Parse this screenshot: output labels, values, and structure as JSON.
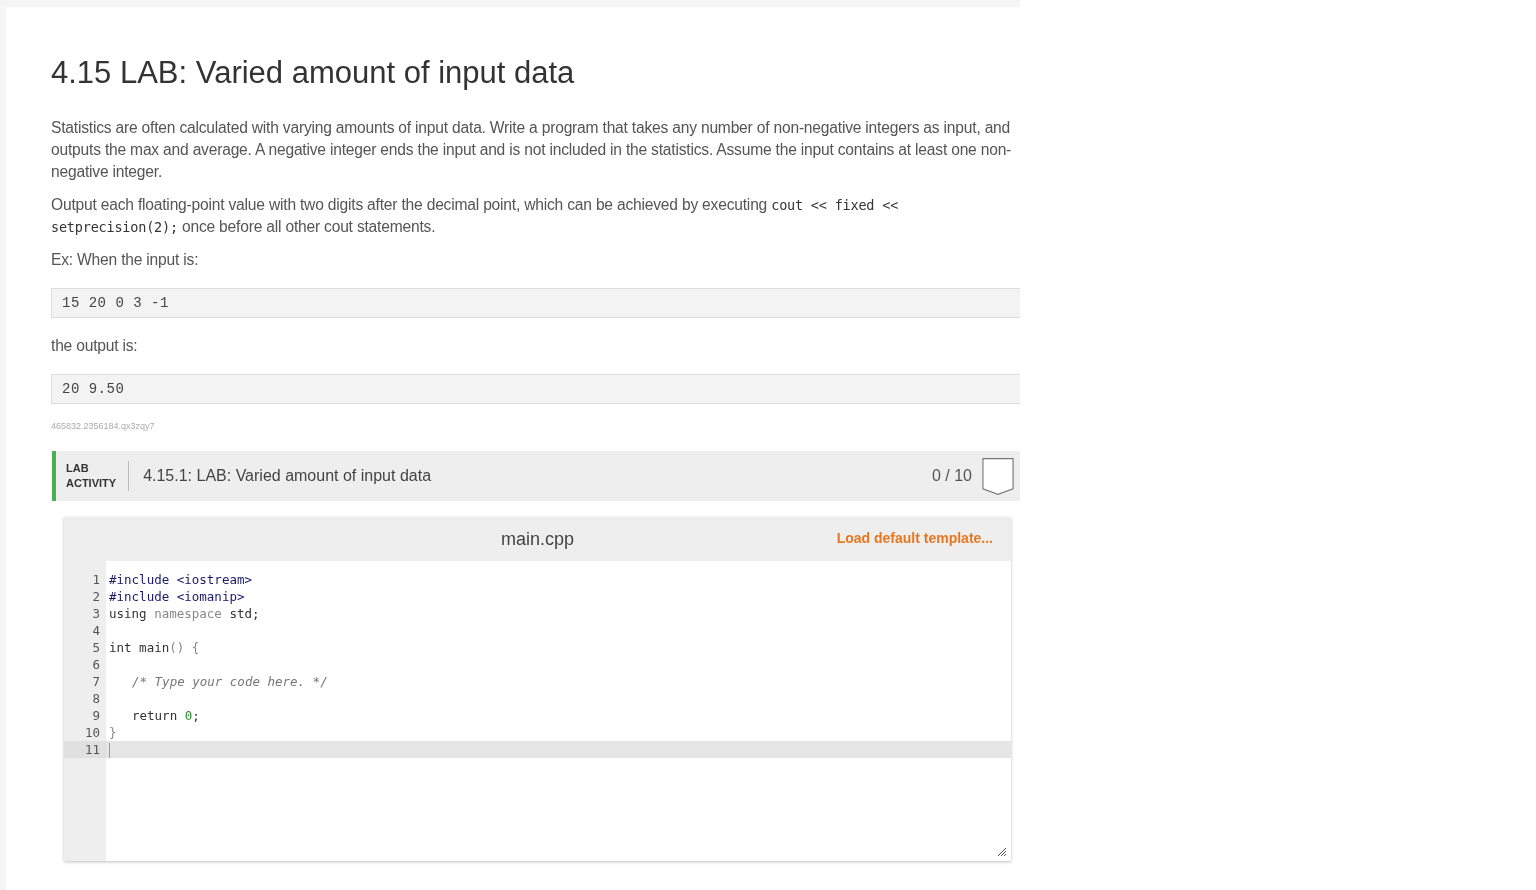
{
  "title": "4.15 LAB: Varied amount of input data",
  "paragraphs": [
    [
      {
        "kind": "text",
        "text": "Statistics are often calculated with varying amounts of input data. Write a program that takes any number of non-negative integers as input, and outputs the max and average. A negative integer ends the input and is not included in the statistics. Assume the input contains at least one non-negative integer."
      }
    ],
    [
      {
        "kind": "text",
        "text": "Output each floating-point value with two digits after the decimal point, which can be achieved by executing "
      },
      {
        "kind": "code",
        "text": "cout << fixed << setprecision(2);"
      },
      {
        "kind": "text",
        "text": " once before all other cout statements."
      }
    ]
  ],
  "example_input_label": "Ex: When the input is:",
  "example_input": "15 20 0 3 -1",
  "example_output_label": "the output is:",
  "example_output": "20 9.50",
  "content_id": "465832.2356184.qx3zqy7",
  "lab": {
    "tag_lines": [
      "LAB",
      "ACTIVITY"
    ],
    "title": "4.15.1: LAB: Varied amount of input data",
    "score": "0 / 10"
  },
  "editor": {
    "filename": "main.cpp",
    "load_template": "Load default template...",
    "lines": [
      {
        "number": "1",
        "active": false,
        "tokens": [
          {
            "kind": "meta",
            "text": "#include <iostream>"
          }
        ]
      },
      {
        "number": "2",
        "active": false,
        "tokens": [
          {
            "kind": "meta",
            "text": "#include <iomanip>"
          }
        ]
      },
      {
        "number": "3",
        "active": false,
        "tokens": [
          {
            "kind": "keyword",
            "text": "using "
          },
          {
            "kind": "faint",
            "text": "namespace"
          },
          {
            "kind": "plain",
            "text": " std;"
          }
        ]
      },
      {
        "number": "4",
        "active": false
      },
      {
        "number": "5",
        "active": false,
        "tokens": [
          {
            "kind": "keyword",
            "text": "int"
          },
          {
            "kind": "plain",
            "text": " main"
          },
          {
            "kind": "faint",
            "text": "() {"
          }
        ]
      },
      {
        "number": "6",
        "active": false
      },
      {
        "number": "7",
        "active": false,
        "indented": true,
        "tokens": [
          {
            "kind": "comment",
            "text": "/* Type your code here. */"
          }
        ]
      },
      {
        "number": "8",
        "active": false
      },
      {
        "number": "9",
        "active": false,
        "indented": true,
        "tokens": [
          {
            "kind": "keyword",
            "text": "return "
          },
          {
            "kind": "number",
            "text": "0"
          },
          {
            "kind": "plain",
            "text": ";"
          }
        ]
      },
      {
        "number": "10",
        "active": false,
        "tokens": [
          {
            "kind": "faint",
            "text": "}"
          }
        ]
      },
      {
        "number": "11",
        "active": true
      }
    ]
  }
}
